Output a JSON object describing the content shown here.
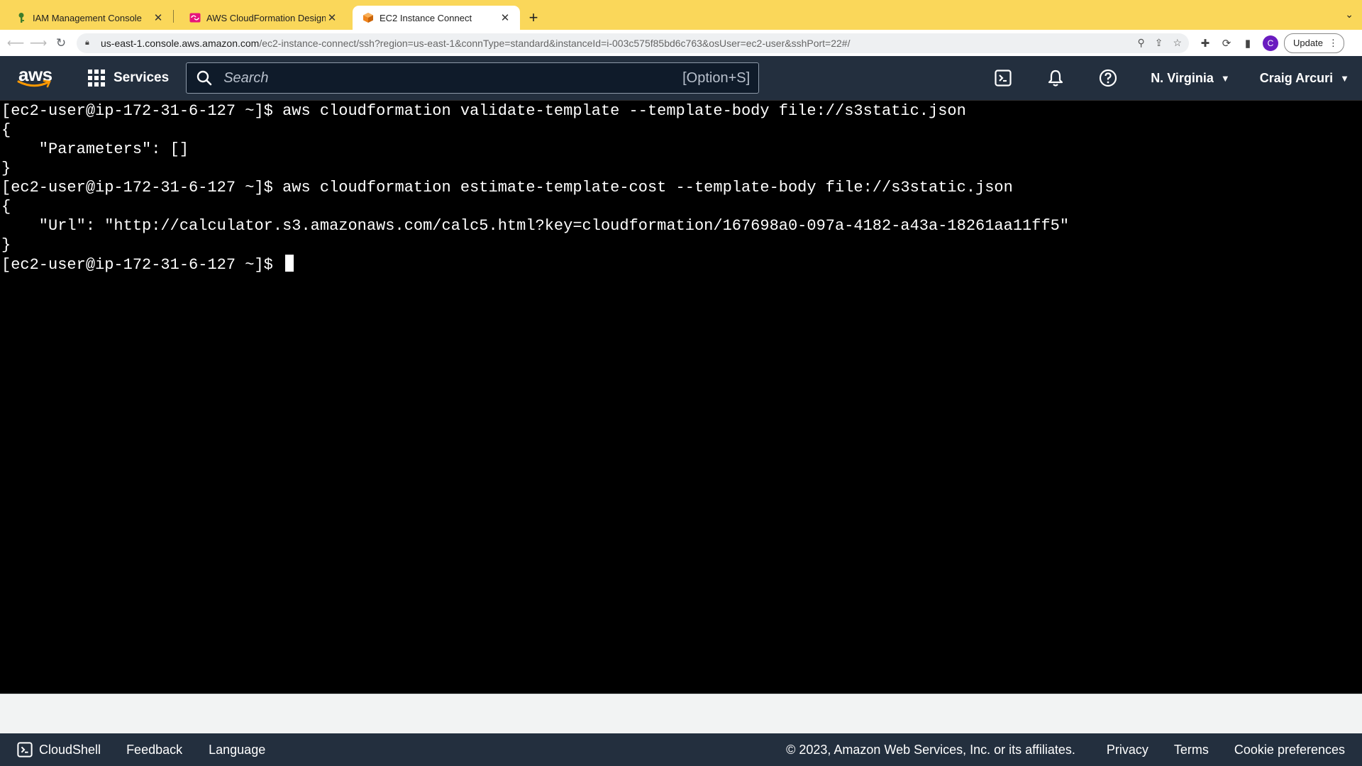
{
  "browser": {
    "tabs": [
      {
        "title": "IAM Management Console",
        "active": false
      },
      {
        "title": "AWS CloudFormation Designer",
        "active": false
      },
      {
        "title": "EC2 Instance Connect",
        "active": true
      }
    ],
    "url_host": "us-east-1.console.aws.amazon.com",
    "url_path": "/ec2-instance-connect/ssh?region=us-east-1&connType=standard&instanceId=i-003c575f85bd6c763&osUser=ec2-user&sshPort=22#/",
    "profile_initial": "C",
    "update_label": "Update"
  },
  "aws_header": {
    "logo_text": "aws",
    "services_label": "Services",
    "search_placeholder": "Search",
    "search_shortcut": "[Option+S]",
    "region": "N. Virginia",
    "user": "Craig Arcuri"
  },
  "terminal": {
    "lines": [
      "[ec2-user@ip-172-31-6-127 ~]$ aws cloudformation validate-template --template-body file://s3static.json",
      "{",
      "    \"Parameters\": []",
      "}",
      "[ec2-user@ip-172-31-6-127 ~]$ aws cloudformation estimate-template-cost --template-body file://s3static.json",
      "{",
      "    \"Url\": \"http://calculator.s3.amazonaws.com/calc5.html?key=cloudformation/167698a0-097a-4182-a43a-18261aa11ff5\"",
      "}"
    ],
    "prompt": "[ec2-user@ip-172-31-6-127 ~]$ "
  },
  "footer": {
    "cloudshell": "CloudShell",
    "feedback": "Feedback",
    "language": "Language",
    "copyright": "© 2023, Amazon Web Services, Inc. or its affiliates.",
    "privacy": "Privacy",
    "terms": "Terms",
    "cookie": "Cookie preferences"
  },
  "colors": {
    "tab_strip": "#fad75a",
    "aws_nav": "#232f3e",
    "aws_orange": "#ff9900",
    "terminal_bg": "#000000"
  },
  "icons": [
    "key-icon",
    "cloudformation-icon",
    "ec2-cube-icon",
    "close-icon",
    "plus-icon",
    "back-icon",
    "forward-icon",
    "reload-icon",
    "lock-icon",
    "zoom-icon",
    "share-icon",
    "star-icon",
    "puzzle-icon",
    "sync-icon",
    "sidepanel-icon",
    "grid-icon",
    "search-icon",
    "cloudshell-icon",
    "bell-icon",
    "help-icon",
    "caret-down-icon"
  ]
}
